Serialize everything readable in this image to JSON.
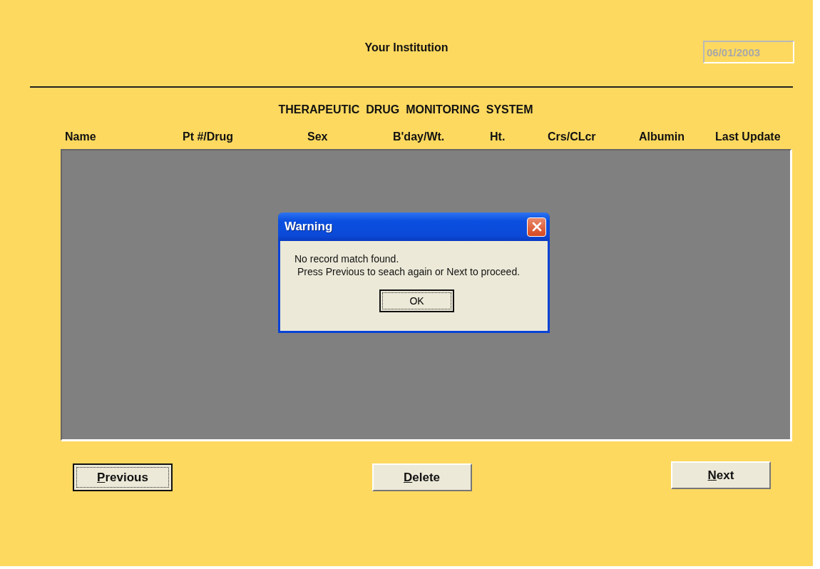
{
  "header": {
    "institution": "Your Institution",
    "date_field": {
      "value": "06/01/2003",
      "disabled": true
    }
  },
  "title": "THERAPEUTIC  DRUG  MONITORING  SYSTEM",
  "table": {
    "columns": [
      "Name",
      "Pt #/Drug",
      "Sex",
      "B'day/Wt.",
      "Ht.",
      "Crs/CLcr",
      "Albumin",
      "Last Update"
    ]
  },
  "buttons": [
    {
      "label": "Previous",
      "focused": true
    },
    {
      "label": "Delete",
      "focused": false
    },
    {
      "label": "Next",
      "focused": false
    }
  ],
  "dialog": {
    "title": "Warning",
    "message": [
      "No record match found.",
      "Press Previous to seach again or Next to proceed."
    ],
    "button": {
      "label": "OK",
      "focused": true
    }
  }
}
